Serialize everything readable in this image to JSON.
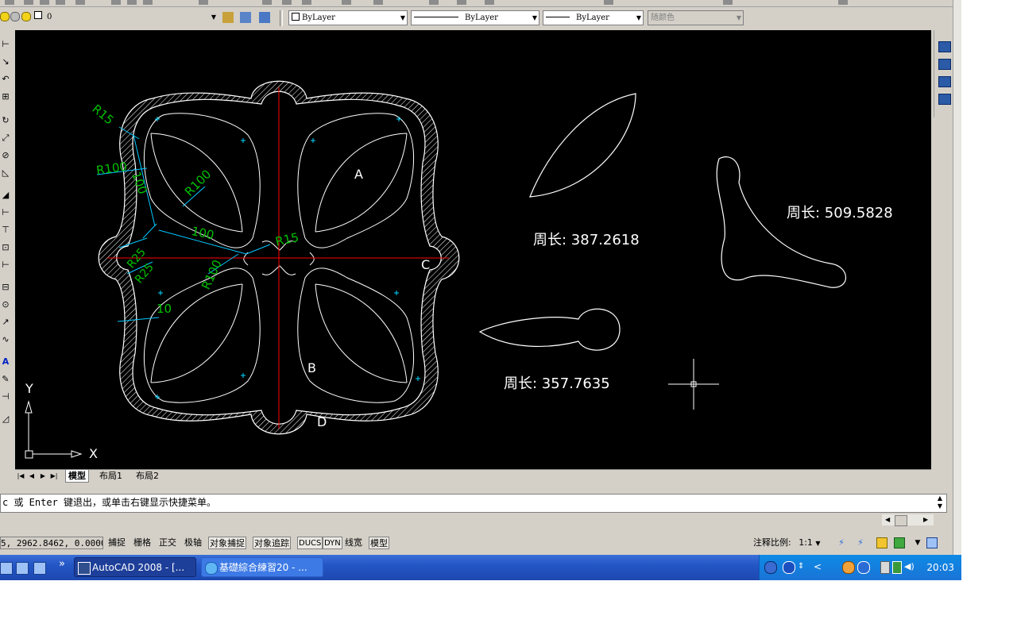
{
  "layer_toolbar": {
    "layer_name": "0",
    "color_value": "ByLayer",
    "linetype_value": "ByLayer",
    "lineweight_value": "ByLayer",
    "plotstyle_value": "随颜色"
  },
  "drawing": {
    "labels": {
      "a": "A",
      "b": "B",
      "c": "C",
      "d": "D",
      "axis_y": "Y",
      "axis_x": "X",
      "perimeter_label": "周长",
      "perimeter_1": ": 387.2618",
      "perimeter_2": ": 509.5828",
      "perimeter_3": ": 357.7635"
    },
    "dimensions": {
      "r15_top": "R15",
      "r100_left": "R100",
      "d100_vertical": "100",
      "r100_inner": "R100",
      "d100_horizontal": "100",
      "r15_center": "R15",
      "r25_a": "R25",
      "r25_b": "R25",
      "r100_lower": "R100",
      "d10": "10"
    },
    "colors": {
      "background": "#000000",
      "geometry": "#ffffff",
      "centerline": "#ff0000",
      "dimension": "#00c000",
      "dimension_line": "#00c8ff",
      "text": "#ffffff"
    }
  },
  "layout_tabs": {
    "tabs": [
      "模型",
      "布局1",
      "布局2"
    ]
  },
  "command_line": {
    "text": "c 或 Enter 键退出，或单击右键显示快捷菜单。"
  },
  "status_bar": {
    "coordinates": "5, 2962.8462, 0.0000",
    "toggles": [
      "捕捉",
      "栅格",
      "正交",
      "极轴",
      "对象捕捉",
      "对象追踪",
      "DUCS",
      "DYN",
      "线宽",
      "模型"
    ],
    "annotation_scale_label": "注释比例:",
    "annotation_scale_value": "1:1"
  },
  "taskbar": {
    "overflow": "»",
    "tasks": [
      {
        "label": "AutoCAD 2008 - [...",
        "icon": "autocad-icon"
      },
      {
        "label": "基礎綜合練習20 - ...",
        "icon": "ie-icon"
      }
    ],
    "clock": "20:03"
  }
}
